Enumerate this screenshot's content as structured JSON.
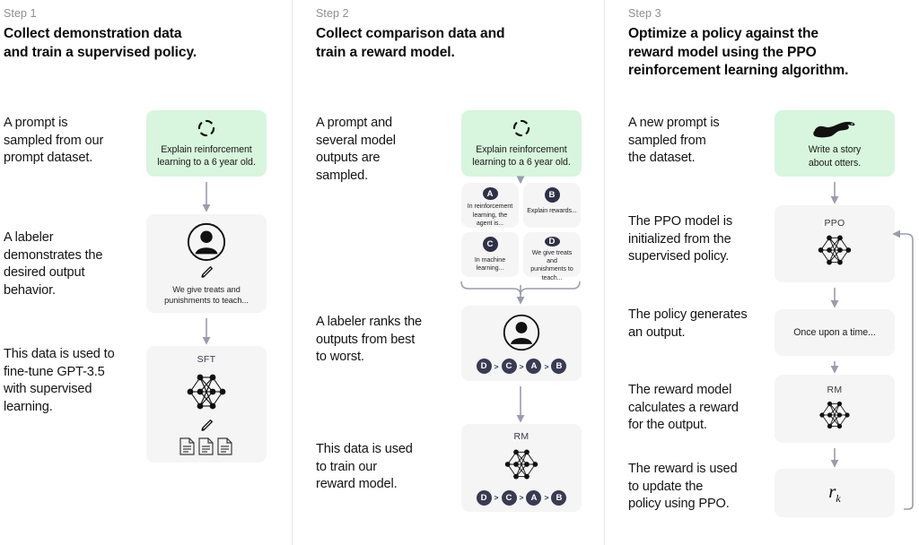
{
  "meta": {
    "accent_green": "#d7f6dd",
    "card_gray": "#f5f5f5",
    "badge_navy": "#2e3147",
    "arrow_gray": "#9b9bae",
    "divider": "#e6e6e6"
  },
  "columns": [
    {
      "step_label": "Step 1",
      "step_title_line1": "Collect demonstration data",
      "step_title_line2": "and train a supervised policy.",
      "descriptions": [
        "A prompt is\nsampled from our\nprompt dataset.",
        "A labeler\ndemonstrates the\ndesired output\nbehavior.",
        "This data is used to\nfine-tune GPT-3.5\nwith supervised\nlearning."
      ],
      "cards": [
        {
          "name": "prompt-card",
          "icon": "dashed-circle-icon",
          "text": "Explain reinforcement\nlearning to a 6 year old.",
          "style": "green"
        },
        {
          "name": "labeler-card",
          "icon": "labeler-person-icon",
          "text": "We give treats and\npunishments to teach...",
          "style": "gray"
        },
        {
          "name": "sft-model-card",
          "label": "SFT",
          "icon": "neural-network-icon",
          "style": "gray"
        }
      ]
    },
    {
      "step_label": "Step 2",
      "step_title_line1": "Collect comparison data and",
      "step_title_line2": "train a reward model.",
      "descriptions": [
        "A prompt and\nseveral model\noutputs are\nsampled.",
        "A labeler ranks the\noutputs from best\nto worst.",
        "This data is used\nto train our\nreward model."
      ],
      "cards": [
        {
          "name": "prompt-card",
          "icon": "dashed-circle-icon",
          "text": "Explain reinforcement\nlearning to a 6 year old.",
          "style": "green"
        },
        {
          "name": "ranking-card",
          "icon": "labeler-person-icon",
          "style": "gray"
        },
        {
          "name": "rm-model-card",
          "label": "RM",
          "icon": "neural-network-icon",
          "style": "gray"
        }
      ],
      "outputs": [
        {
          "badge": "A",
          "text": "In reinforcement\nlearning, the\nagent is..."
        },
        {
          "badge": "B",
          "text": "Explain rewards..."
        },
        {
          "badge": "C",
          "text": "In machine\nlearning..."
        },
        {
          "badge": "D",
          "text": "We give treats and\npunishments to\nteach..."
        }
      ],
      "ranking": [
        "D",
        "C",
        "A",
        "B"
      ],
      "ranking_separator": ">"
    },
    {
      "step_label": "Step 3",
      "step_title_line1": "Optimize a policy against the",
      "step_title_line2": "reward model using the PPO",
      "step_title_line3": "reinforcement learning algorithm.",
      "descriptions": [
        "A new prompt is\nsampled from\nthe dataset.",
        "The PPO model is\ninitialized from the\nsupervised policy.",
        "The policy generates\nan output.",
        "The reward model\ncalculates a reward\nfor the output.",
        "The reward is used\nto update the\npolicy using PPO."
      ],
      "cards": [
        {
          "name": "prompt-card",
          "icon": "otter-icon",
          "text": "Write a story\nabout otters.",
          "style": "green"
        },
        {
          "name": "ppo-model-card",
          "label": "PPO",
          "icon": "neural-network-icon",
          "style": "gray"
        },
        {
          "name": "output-card",
          "text": "Once upon a time...",
          "style": "gray"
        },
        {
          "name": "rm-model-card",
          "label": "RM",
          "icon": "neural-network-icon",
          "style": "gray"
        },
        {
          "name": "reward-card",
          "formula_base": "r",
          "formula_sub": "k",
          "style": "gray"
        }
      ]
    }
  ]
}
